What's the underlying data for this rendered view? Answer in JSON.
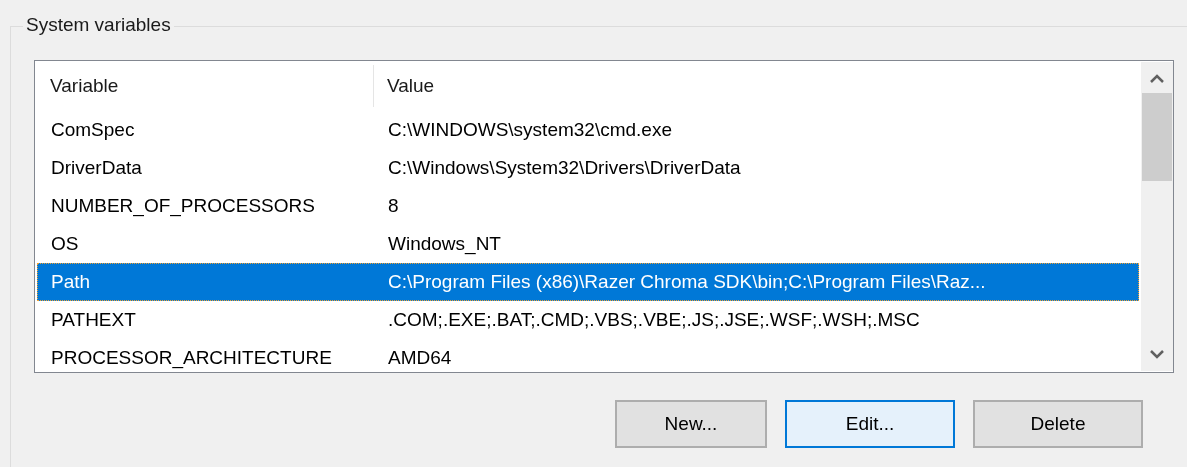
{
  "group": {
    "title": "System variables"
  },
  "table": {
    "columns": [
      "Variable",
      "Value"
    ],
    "rows": [
      {
        "cells": [
          "ComSpec",
          "C:\\WINDOWS\\system32\\cmd.exe"
        ],
        "selected": false
      },
      {
        "cells": [
          "DriverData",
          "C:\\Windows\\System32\\Drivers\\DriverData"
        ],
        "selected": false
      },
      {
        "cells": [
          "NUMBER_OF_PROCESSORS",
          "8"
        ],
        "selected": false
      },
      {
        "cells": [
          "OS",
          "Windows_NT"
        ],
        "selected": false
      },
      {
        "cells": [
          "Path",
          "C:\\Program Files (x86)\\Razer Chroma SDK\\bin;C:\\Program Files\\Raz..."
        ],
        "selected": true
      },
      {
        "cells": [
          "PATHEXT",
          ".COM;.EXE;.BAT;.CMD;.VBS;.VBE;.JS;.JSE;.WSF;.WSH;.MSC"
        ],
        "selected": false
      },
      {
        "cells": [
          "PROCESSOR_ARCHITECTURE",
          "AMD64"
        ],
        "selected": false
      }
    ]
  },
  "buttons": [
    {
      "label": "New...",
      "focused": false
    },
    {
      "label": "Edit...",
      "focused": true
    },
    {
      "label": "Delete",
      "focused": false
    }
  ]
}
